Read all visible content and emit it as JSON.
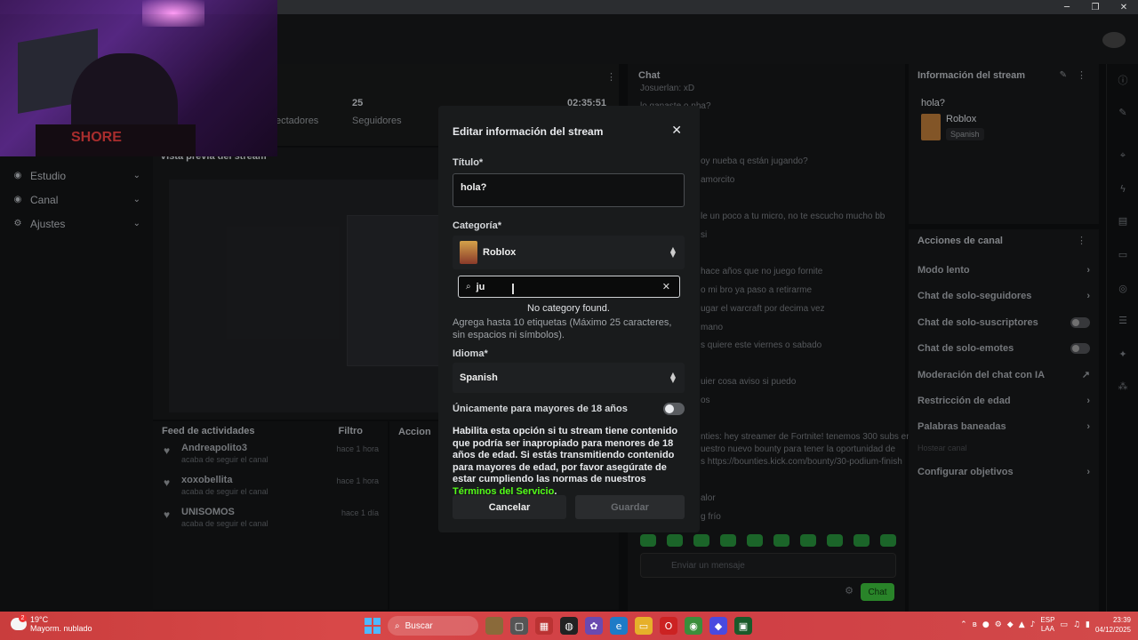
{
  "window": {
    "minimize": "─",
    "maximize": "❐",
    "close": "✕"
  },
  "webcam": {
    "shirt_text": "SHORE"
  },
  "sidebar": {
    "items": [
      {
        "icon": "studio-icon",
        "label": "Estudio"
      },
      {
        "icon": "channel-icon",
        "label": "Canal"
      },
      {
        "icon": "gear-icon",
        "label": "Ajustes"
      }
    ]
  },
  "stats": {
    "followers_value": "25",
    "followers_label": "Seguidores",
    "spectators_label": "ectadores",
    "uptime": "02:35:51"
  },
  "preview": {
    "header": "Vista previa del stream"
  },
  "feed": {
    "header": "Feed de actividades",
    "filter": "Filtro",
    "items": [
      {
        "name": "Andreapolito3",
        "sub": "acaba de seguir el canal",
        "time": "hace 1 hora"
      },
      {
        "name": "xoxobellita",
        "sub": "acaba de seguir el canal",
        "time": "hace 1 hora"
      },
      {
        "name": "UNISOMOS",
        "sub": "acaba de seguir el canal",
        "time": "hace 1 día"
      }
    ]
  },
  "actions_mid": {
    "header": "Accion"
  },
  "chat": {
    "header": "Chat",
    "lines": [
      "Josuerlan: xD",
      "lo ganaste o nha?",
      "oy nueba q están jugando?",
      "amorcito",
      "le un poco a tu micro, no te escucho mucho bb",
      "si",
      "hace años que no juego fornite",
      "o mi bro ya paso a retirarme",
      "ugar el warcraft por decima vez",
      "mano",
      "s quiere este viernes o sabado",
      "uier cosa aviso si puedo",
      "os",
      "nties: hey streamer de Fortnite! tenemos 300 subs en",
      "uestro nuevo bounty para tener la oportunidad de",
      "s https://bounties.kick.com/bounty/30-podium-finish",
      "alor",
      "g frío"
    ],
    "input_placeholder": "Enviar un mensaje",
    "send": "Chat"
  },
  "info": {
    "header": "Información del stream",
    "title": "hola?",
    "category": "Roblox",
    "language": "Spanish"
  },
  "channel_actions": {
    "header": "Acciones de canal",
    "items": [
      {
        "label": "Modo lento",
        "kind": "arrow"
      },
      {
        "label": "Chat de solo-seguidores",
        "kind": "arrow"
      },
      {
        "label": "Chat de solo-suscriptores",
        "kind": "toggle"
      },
      {
        "label": "Chat de solo-emotes",
        "kind": "toggle"
      },
      {
        "label": "Moderación del chat con IA",
        "kind": "external"
      },
      {
        "label": "Restricción de edad",
        "kind": "arrow"
      },
      {
        "label": "Palabras baneadas",
        "kind": "arrow"
      },
      {
        "label": "Configurar objetivos",
        "kind": "arrow"
      }
    ],
    "faded_item": "Hostear canal"
  },
  "modal": {
    "title": "Editar información del stream",
    "title_label": "Título*",
    "title_value": "hola?",
    "category_label": "Categoría*",
    "category_value": "Roblox",
    "search_value": "ju",
    "no_category": "No category found.",
    "tags_hint": "Agrega hasta 10 etiquetas (Máximo 25 caracteres, sin espacios ni símbolos).",
    "language_label": "Idioma*",
    "language_value": "Spanish",
    "adult_label": "Únicamente para mayores de 18 años",
    "adult_desc": "Habilita esta opción si tu stream tiene contenido que podría ser inapropiado para menores de 18 años de edad. Si estás transmitiendo contenido para mayores de edad, por favor asegúrate de estar cumpliendo las normas de nuestros",
    "tos_link": "Términos del Servicio",
    "tos_end": ".",
    "cancel": "Cancelar",
    "save": "Guardar",
    "accent": "#53fc18"
  },
  "taskbar": {
    "weather_badge": "2",
    "temperature": "19°C",
    "weather": "Mayorm. nublado",
    "search": "Buscar",
    "lang_top": "ESP",
    "lang_bottom": "LAA",
    "time": "23:39",
    "date": "04/12/2025"
  }
}
